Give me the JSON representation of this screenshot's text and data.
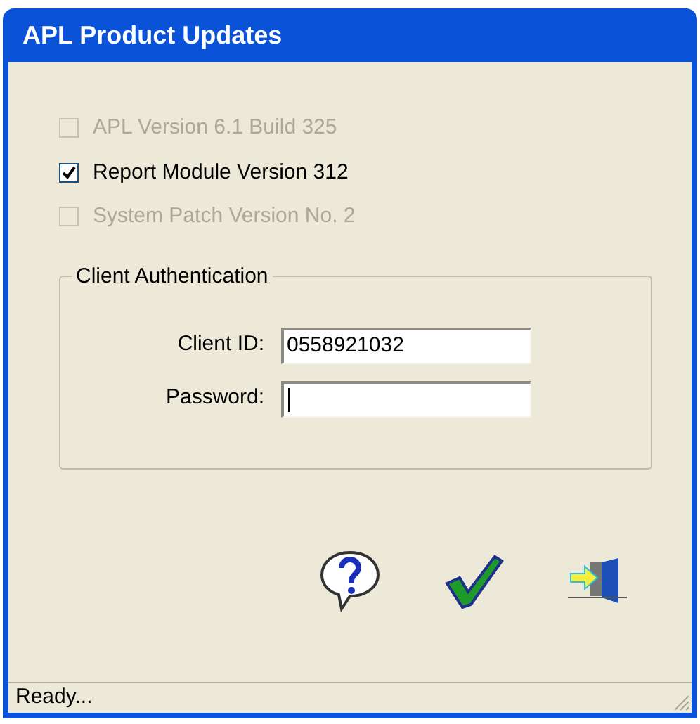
{
  "window": {
    "title": "APL Product Updates"
  },
  "updates": [
    {
      "label": "APL Version 6.1 Build 325",
      "checked": false,
      "disabled": true
    },
    {
      "label": "Report Module Version 312",
      "checked": true,
      "disabled": false
    },
    {
      "label": "System Patch Version No. 2",
      "checked": false,
      "disabled": true
    }
  ],
  "authentication": {
    "title": "Client Authentication",
    "fields": [
      {
        "label": "Client ID:",
        "value": "0558921032",
        "focused": false
      },
      {
        "label": "Password:",
        "focused": true
      }
    ]
  },
  "status_bar": {
    "text": "Ready..."
  }
}
